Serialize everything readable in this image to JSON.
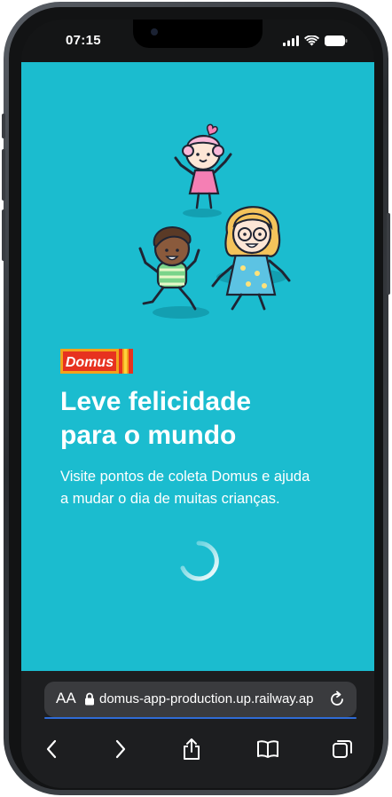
{
  "status_bar": {
    "time": "07:15",
    "icons": [
      "signal-icon",
      "wifi-icon",
      "battery-icon"
    ]
  },
  "page": {
    "background_color": "#1bbccf",
    "illustration": "kids-illustration",
    "logo_text": "Domus",
    "headline_lines": [
      "Leve felicidade",
      "para o mundo"
    ],
    "subtitle_lines": [
      "Visite pontos de coleta Domus e ajuda",
      "a mudar o dia de muitas crianças."
    ],
    "loading": true
  },
  "browser": {
    "text_size_label": "AA",
    "url": "domus-app-production.up.railway.ap",
    "nav_icons": [
      "back-icon",
      "forward-icon",
      "share-icon",
      "bookmarks-icon",
      "tabs-icon"
    ]
  }
}
